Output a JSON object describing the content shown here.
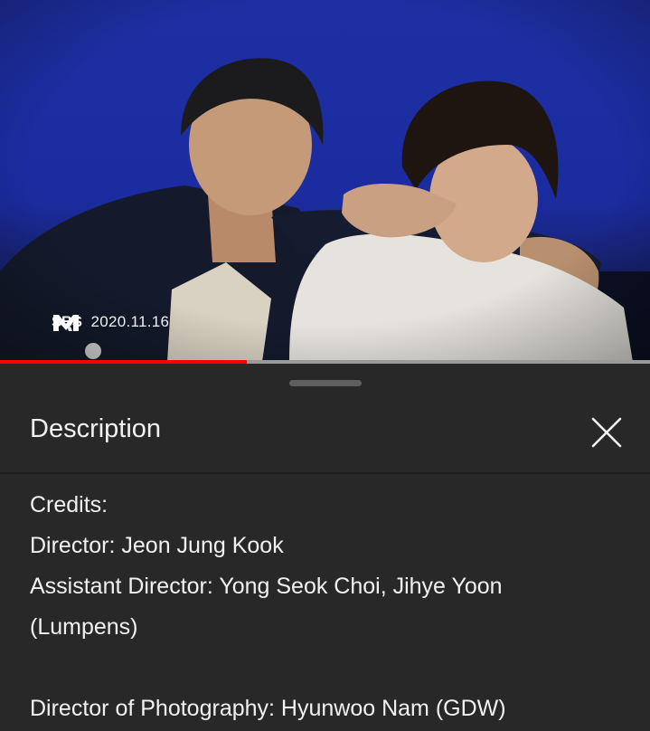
{
  "video": {
    "channel_logo": "SBS MTV",
    "date": "2020.11.16",
    "progress_fraction": 0.38,
    "colors": {
      "sky": "#1c2ea1",
      "progress_played": "#ff0000",
      "progress_track": "#9a9a9a"
    }
  },
  "sheet": {
    "title": "Description",
    "close_icon": "close-icon",
    "lines": [
      "Credits:",
      "Director: Jeon Jung Kook",
      "Assistant Director: Yong Seok Choi, Jihye Yoon",
      "(Lumpens)",
      "",
      "Director of Photography: Hyunwoo Nam (GDW)"
    ],
    "colors": {
      "background": "#282828",
      "text": "#f1f1f1",
      "handle": "#5e5e5e"
    }
  }
}
